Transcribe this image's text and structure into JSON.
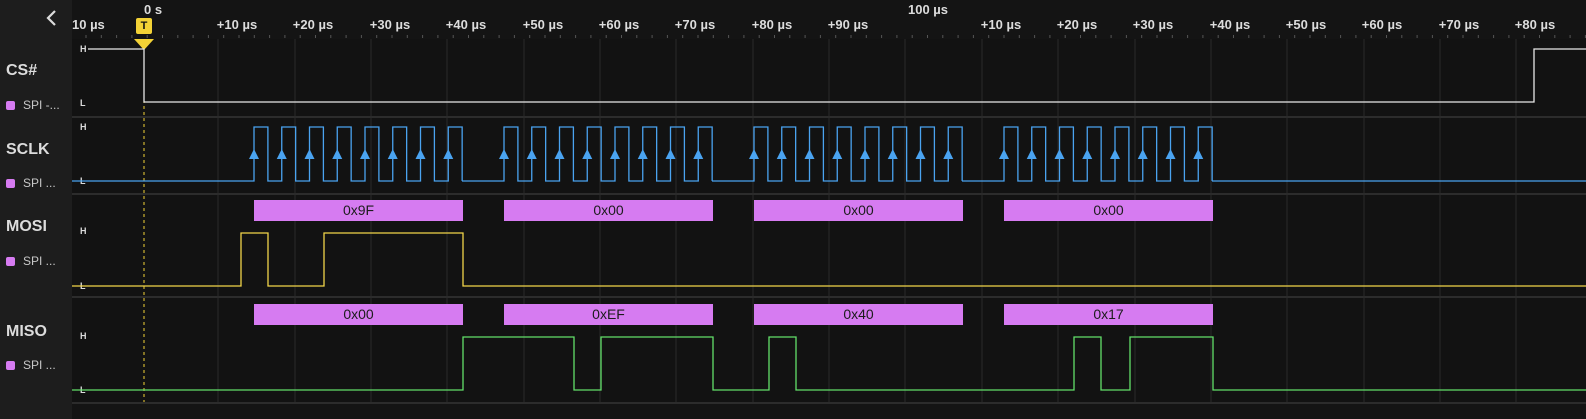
{
  "sidebar": {
    "channels": [
      {
        "name": "CS#",
        "sub": "SPI -..."
      },
      {
        "name": "SCLK",
        "sub": "SPI ..."
      },
      {
        "name": "MOSI",
        "sub": "SPI ..."
      },
      {
        "name": "MISO",
        "sub": "SPI ..."
      }
    ]
  },
  "ruler": {
    "zero_label": "0 s",
    "major_label": "100 µs",
    "trigger_label": "T",
    "tick_labels": [
      "10 µs",
      "+10 µs",
      "+20 µs",
      "+30 µs",
      "+40 µs",
      "+50 µs",
      "+60 µs",
      "+70 µs",
      "+80 µs",
      "+90 µs",
      "+10 µs",
      "+20 µs",
      "+30 µs",
      "+40 µs",
      "+50 µs",
      "+60 µs",
      "+70 µs",
      "+80 µs"
    ]
  },
  "levels": {
    "high": "H",
    "low": "L"
  },
  "decoded": {
    "mosi": [
      "0x9F",
      "0x00",
      "0x00",
      "0x00"
    ],
    "miso": [
      "0x00",
      "0xEF",
      "0x40",
      "0x17"
    ]
  },
  "colors": {
    "cs": "#e8e8e8",
    "sclk": "#4aa3f0",
    "mosi": "#f1d54a",
    "miso": "#62e06a",
    "decode": "#d67bf1",
    "trigger": "#f3d236"
  },
  "icons": {
    "collapse": "chevron-left-icon",
    "trigger": "trigger-marker-icon"
  }
}
